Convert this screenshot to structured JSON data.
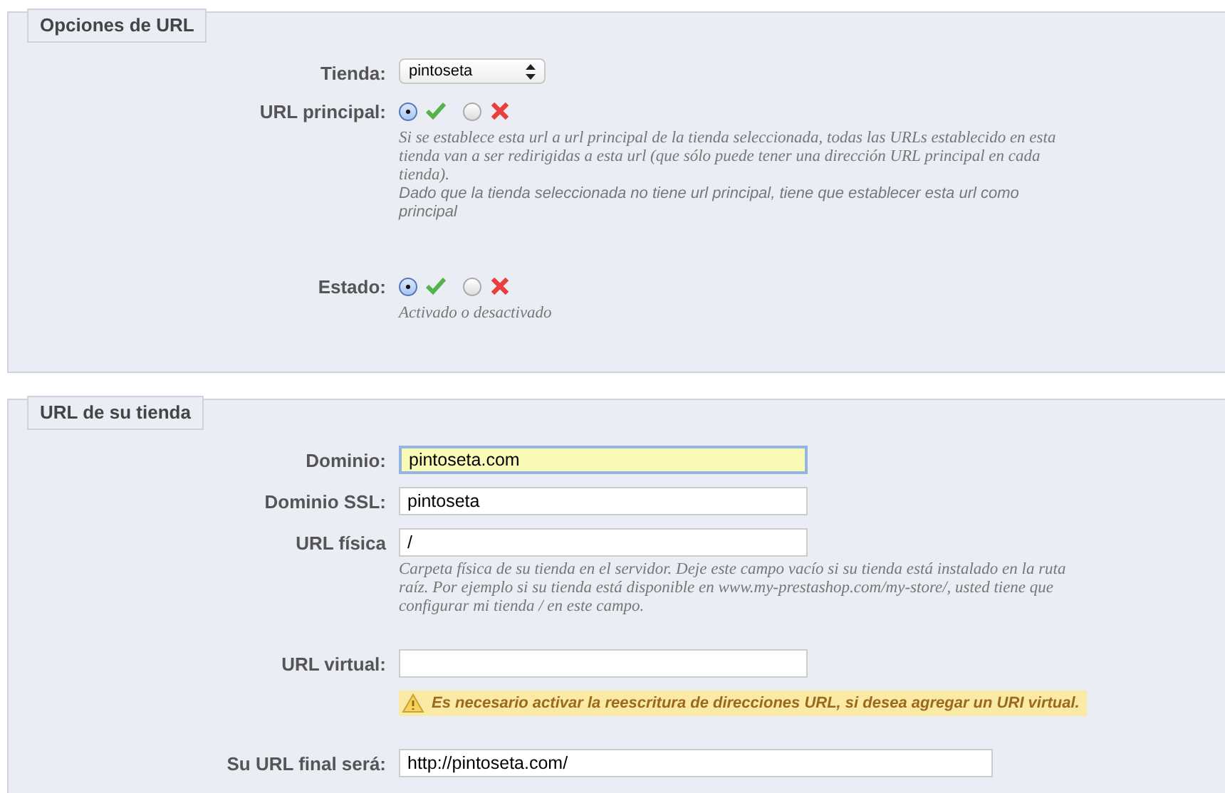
{
  "sections": [
    {
      "legend": "Opciones de URL",
      "fields": [
        {
          "kind": "select",
          "label": "Tienda:",
          "value": "pintoseta"
        },
        {
          "kind": "radio",
          "label": "URL principal:",
          "options": [
            {
              "kind": "yes",
              "selected": true
            },
            {
              "kind": "no",
              "selected": false
            }
          ],
          "hints": [
            {
              "kind": "serif",
              "text": "Si se establece esta url a url principal de la tienda seleccionada, todas las URLs establecido en esta tienda van a ser redirigidas a esta url (que sólo puede tener una dirección URL principal en cada tienda)."
            },
            {
              "kind": "sans",
              "text": "Dado que la tienda seleccionada no tiene url principal, tiene que establecer esta url como principal"
            }
          ]
        },
        {
          "kind": "radio",
          "label": "Estado:",
          "options": [
            {
              "kind": "yes",
              "selected": true
            },
            {
              "kind": "no",
              "selected": false
            }
          ],
          "hints": [
            {
              "kind": "serif",
              "text": "Activado o desactivado"
            }
          ]
        }
      ]
    },
    {
      "legend": "URL de su tienda",
      "fields": [
        {
          "kind": "text",
          "label": "Dominio:",
          "value": "pintoseta.com",
          "focused": true
        },
        {
          "kind": "text",
          "label": "Dominio SSL:",
          "value": "pintoseta",
          "focused": false
        },
        {
          "kind": "text",
          "label": "URL física",
          "value": "/",
          "focused": false,
          "hints": [
            {
              "kind": "serif",
              "text": "Carpeta física de su tienda en el servidor. Deje este campo vacío si su tienda está instalado en la ruta raíz. Por ejemplo si su tienda está disponible en www.my-prestashop.com/my-store/, usted tiene que configurar mi tienda / en este campo."
            }
          ]
        },
        {
          "kind": "text",
          "label": "URL virtual:",
          "focused": false,
          "warning": "Es necesario activar la reescritura de direcciones URL, si desea agregar un URI virtual."
        },
        {
          "kind": "wide",
          "label": "Su URL final será:",
          "value": "http://pintoseta.com/",
          "focused": false
        }
      ]
    }
  ]
}
